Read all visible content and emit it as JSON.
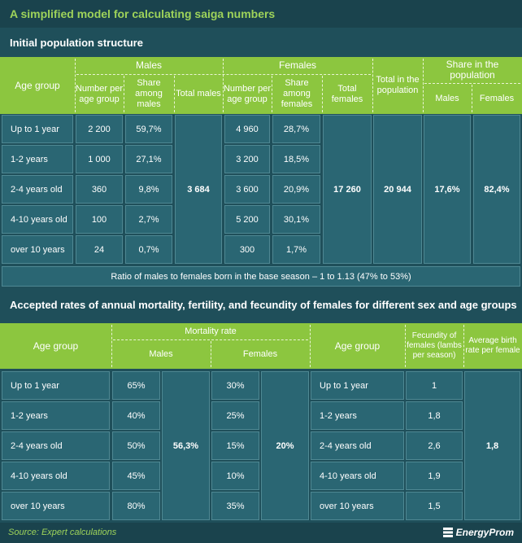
{
  "title": "A simplified model for calculating saiga numbers",
  "t1": {
    "section": "Initial population structure",
    "h_age": "Age group",
    "h_males": "Males",
    "h_females": "Females",
    "h_num_m": "Number per age group",
    "h_share_m": "Share among males",
    "h_total_m": "Total males",
    "h_num_f": "Number per age group",
    "h_share_f": "Share among females",
    "h_total_f": "Total females",
    "h_total_pop": "Total in the population",
    "h_share_pop": "Share in the population",
    "h_share_m2": "Males",
    "h_share_f2": "Females",
    "rows": [
      {
        "age": "Up to 1 year",
        "num_m": "2 200",
        "share_m": "59,7%",
        "num_f": "4 960",
        "share_f": "28,7%"
      },
      {
        "age": "1-2 years",
        "num_m": "1 000",
        "share_m": "27,1%",
        "num_f": "3 200",
        "share_f": "18,5%"
      },
      {
        "age": "2-4 years old",
        "num_m": "360",
        "share_m": "9,8%",
        "num_f": "3 600",
        "share_f": "20,9%"
      },
      {
        "age": "4-10 years old",
        "num_m": "100",
        "share_m": "2,7%",
        "num_f": "5 200",
        "share_f": "30,1%"
      },
      {
        "age": "over 10 years",
        "num_m": "24",
        "share_m": "0,7%",
        "num_f": "300",
        "share_f": "1,7%"
      }
    ],
    "total_m": "3 684",
    "total_f": "17 260",
    "total_pop": "20 944",
    "share_m": "17,6%",
    "share_f": "82,4%",
    "ratio": "Ratio of males to females born in the base season – 1 to 1.13 (47% to 53%)"
  },
  "t2": {
    "section": "Accepted rates of annual mortality, fertility, and fecundity of females for different sex and age groups",
    "h_age": "Age group",
    "h_mortality": "Mortality rate",
    "h_males": "Males",
    "h_females": "Females",
    "h_age2": "Age group",
    "h_fecundity": "Fecundity of females (lambs per season)",
    "h_birth": "Average birth rate per female",
    "rows": [
      {
        "age": "Up to 1 year",
        "m": "65%",
        "f": "30%",
        "age2": "Up to 1 year",
        "fec": "1"
      },
      {
        "age": "1-2 years",
        "m": "40%",
        "f": "25%",
        "age2": "1-2 years",
        "fec": "1,8"
      },
      {
        "age": "2-4 years old",
        "m": "50%",
        "f": "15%",
        "age2": "2-4 years old",
        "fec": "2,6"
      },
      {
        "age": "4-10 years old",
        "m": "45%",
        "f": "10%",
        "age2": "4-10 years old",
        "fec": "1,9"
      },
      {
        "age": "over 10 years",
        "m": "80%",
        "f": "35%",
        "age2": "over 10 years",
        "fec": "1,5"
      }
    ],
    "avg_m": "56,3%",
    "avg_f": "20%",
    "avg_birth": "1,8"
  },
  "footer": {
    "source": "Source: Expert calculations",
    "logo": "EnergyProm"
  }
}
